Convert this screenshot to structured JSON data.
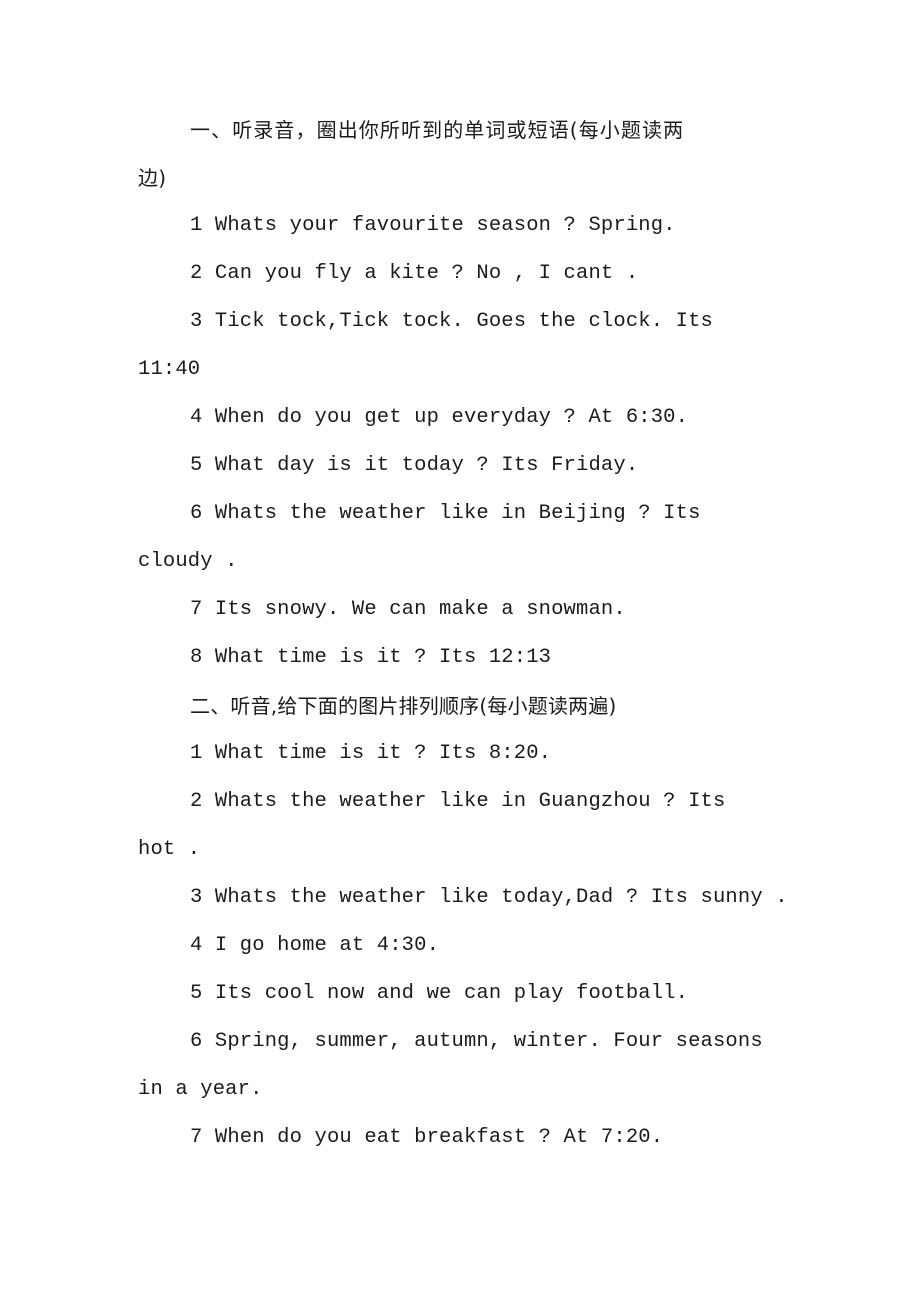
{
  "document": {
    "background_color": "#ffffff",
    "text_color": "#1b1b1b",
    "sections": [
      {
        "id": "section-one",
        "heading_lines": [
          "一、听录音，圈出你所听到的单词或短语(每小题读两",
          "边)"
        ],
        "items": [
          {
            "number": "1",
            "lines": [
              "1 Whats your favourite season ? Spring."
            ]
          },
          {
            "number": "2",
            "lines": [
              "2 Can you fly a kite ? No , I cant ."
            ]
          },
          {
            "number": "3",
            "lines": [
              "3 Tick tock,Tick tock. Goes the clock. Its",
              "11:40"
            ]
          },
          {
            "number": "4",
            "lines": [
              "4 When do you get up everyday ? At 6:30."
            ]
          },
          {
            "number": "5",
            "lines": [
              "5 What day is it today ? Its Friday."
            ]
          },
          {
            "number": "6",
            "lines": [
              "6 Whats the weather like in Beijing ? Its",
              "cloudy ."
            ]
          },
          {
            "number": "7",
            "lines": [
              "7 Its snowy. We can make a snowman."
            ]
          },
          {
            "number": "8",
            "lines": [
              "8 What time is it ? Its 12:13"
            ]
          }
        ]
      },
      {
        "id": "section-two",
        "heading_lines": [
          "二、听音,给下面的图片排列顺序(每小题读两遍)"
        ],
        "items": [
          {
            "number": "1",
            "lines": [
              "1 What time is it ? Its 8:20."
            ]
          },
          {
            "number": "2",
            "lines": [
              "2 Whats the weather like in Guangzhou ? Its",
              "hot ."
            ]
          },
          {
            "number": "3",
            "lines": [
              "3 Whats the weather like today,Dad ? Its sunny ."
            ]
          },
          {
            "number": "4",
            "lines": [
              "4 I go home at 4:30."
            ]
          },
          {
            "number": "5",
            "lines": [
              "5 Its cool now and we can play football."
            ]
          },
          {
            "number": "6",
            "lines": [
              "6 Spring, summer, autumn, winter. Four seasons",
              "in a year."
            ]
          },
          {
            "number": "7",
            "lines": [
              "7 When do you eat breakfast ? At 7:20."
            ]
          }
        ]
      }
    ]
  },
  "lines": {
    "l01": "一、听录音，圈出你所听到的单词或短语(每小题读两",
    "l02": "边)",
    "l03": "1 Whats your favourite season ? Spring.",
    "l04": "2 Can you fly a kite ? No , I cant .",
    "l05": "3 Tick tock,Tick tock. Goes the clock. Its",
    "l06": "11:40",
    "l07": "4 When do you get up everyday ? At 6:30.",
    "l08": "5 What day is it today ? Its Friday.",
    "l09": "6 Whats the weather like in Beijing ? Its",
    "l10": "cloudy .",
    "l11": "7 Its snowy. We can make a snowman.",
    "l12": "8 What time is it ? Its 12:13",
    "l13": "二、听音,给下面的图片排列顺序(每小题读两遍)",
    "l14": "1 What time is it ? Its 8:20.",
    "l15": "2 Whats the weather like in Guangzhou ? Its",
    "l16": "hot .",
    "l17": "3 Whats the weather like today,Dad ? Its sunny .",
    "l18": "4 I go home at 4:30.",
    "l19": "5 Its cool now and we can play football.",
    "l20": "6 Spring, summer, autumn, winter. Four seasons",
    "l21": "in a year.",
    "l22": "7 When do you eat breakfast ? At 7:20."
  }
}
